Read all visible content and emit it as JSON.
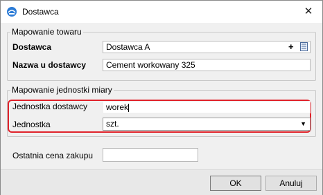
{
  "window": {
    "title": "Dostawca"
  },
  "mapping_goods": {
    "legend": "Mapowanie towaru",
    "supplier_label": "Dostawca",
    "supplier_value": "Dostawca A",
    "supplier_name_label": "Nazwa u dostawcy",
    "supplier_name_value": "Cement workowany 325"
  },
  "mapping_unit": {
    "legend": "Mapowanie jednostki miary",
    "supplier_unit_label": "Jednostka dostawcy",
    "supplier_unit_value": "worek",
    "unit_label": "Jednostka",
    "unit_value": "szt."
  },
  "last_price": {
    "label": "Ostatnia cena zakupu",
    "value": ""
  },
  "buttons": {
    "ok": "OK",
    "cancel": "Anuluj"
  },
  "colors": {
    "highlight": "#e0222a"
  }
}
